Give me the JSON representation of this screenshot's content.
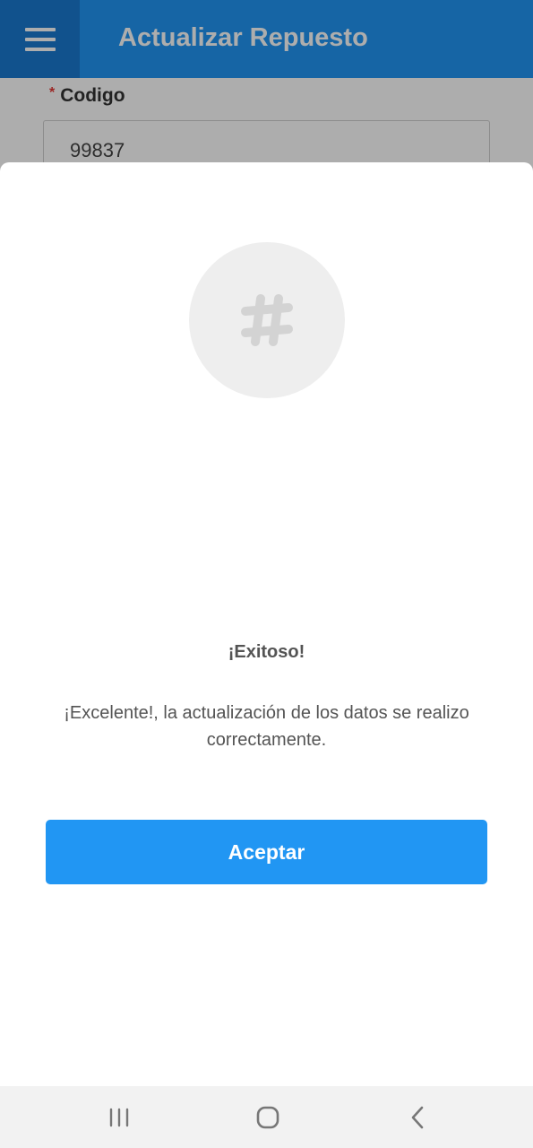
{
  "app_bar": {
    "title": "Actualizar Repuesto",
    "menu_icon": "hamburger-menu-icon",
    "color": "#2196f3"
  },
  "form": {
    "code_field": {
      "required_mark": "*",
      "label": "Codigo",
      "value": "99837"
    }
  },
  "dialog": {
    "icon": "hashtag-icon",
    "title": "¡Exitoso!",
    "message": "¡Excelente!, la actualización de los datos se realizo correctamente.",
    "accept_label": "Aceptar",
    "accent_color": "#2196f3"
  },
  "nav_bar": {
    "buttons": [
      {
        "icon": "recent-apps-icon"
      },
      {
        "icon": "home-icon"
      },
      {
        "icon": "back-icon"
      }
    ]
  }
}
